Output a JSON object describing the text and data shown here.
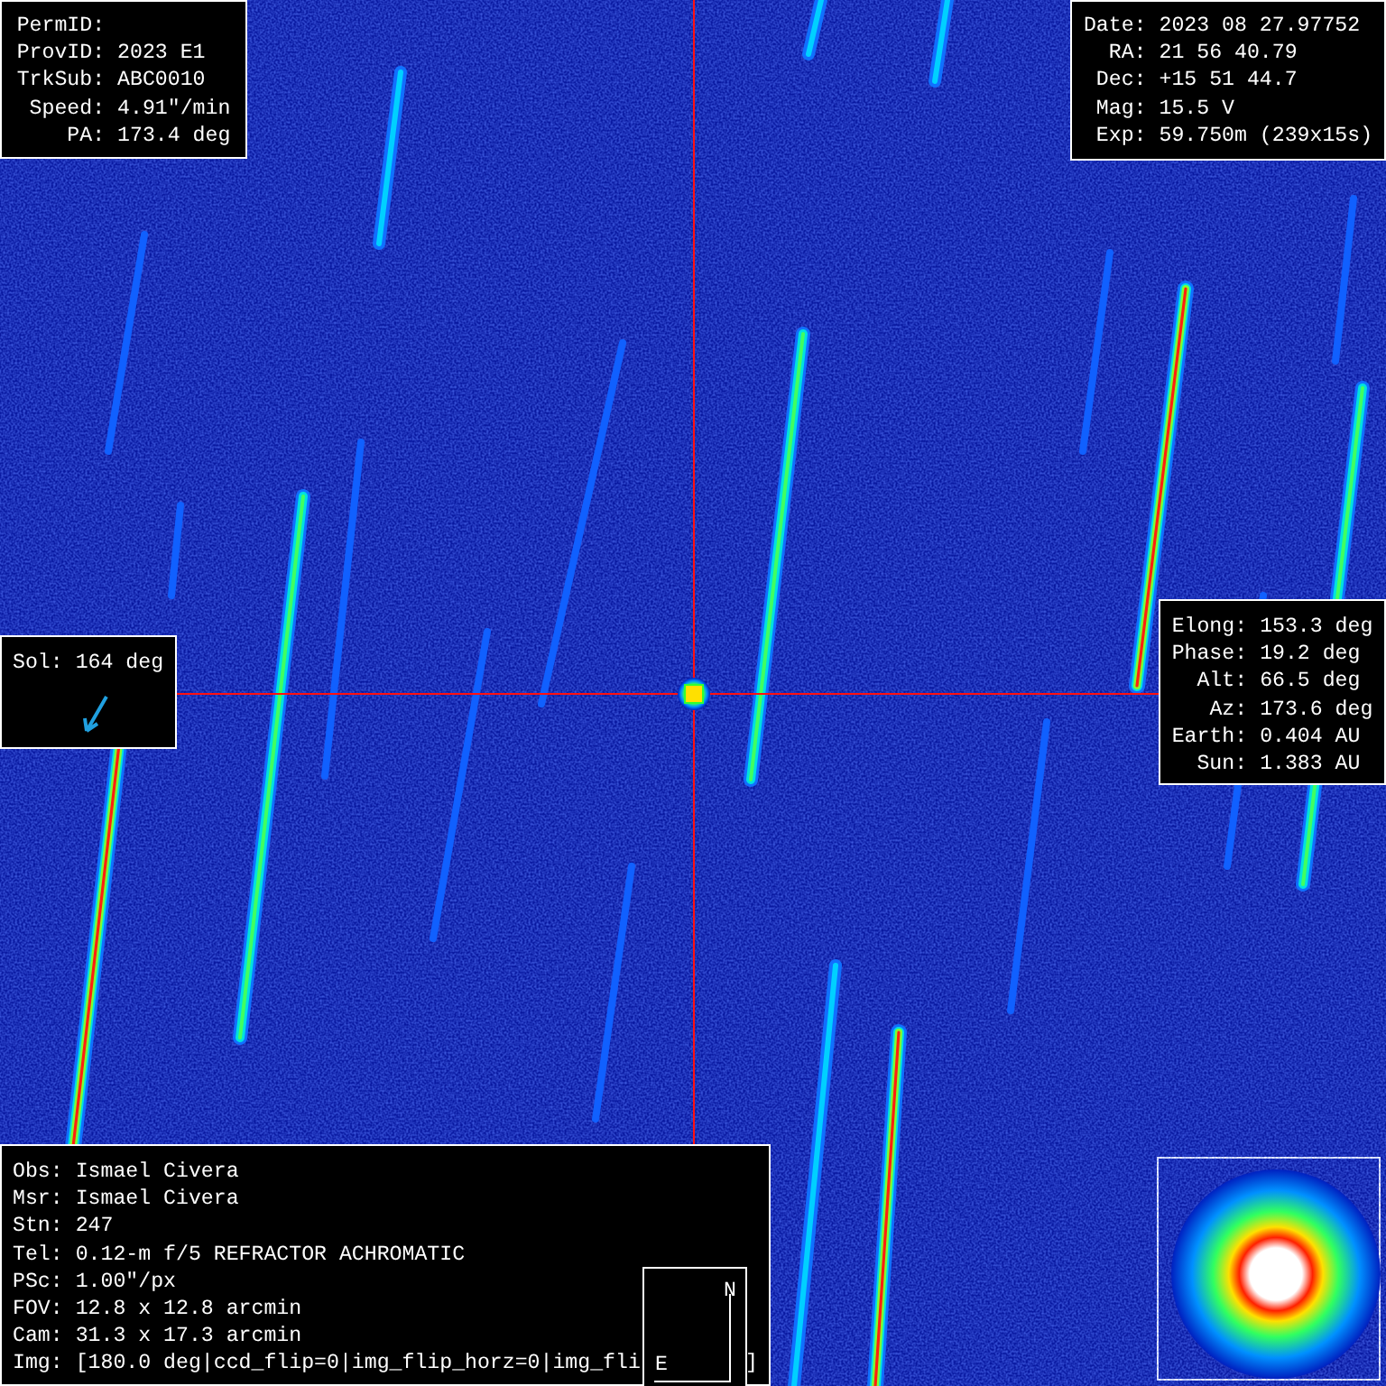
{
  "object_panel": {
    "lines": [
      {
        "label": "PermID:"
      },
      {
        "label": "ProvID:",
        "value": "2023 E1"
      },
      {
        "label": "TrkSub:",
        "value": "ABC0010"
      },
      {
        "label": "Speed:",
        "value": "4.91\"/min"
      },
      {
        "label": "PA:",
        "value": "173.4 deg"
      }
    ]
  },
  "observation_panel": {
    "lines": [
      {
        "label": "Date:",
        "value": "2023 08 27.97752"
      },
      {
        "label": "RA:",
        "value": "21 56 40.79"
      },
      {
        "label": "Dec:",
        "value": "+15 51 44.7"
      },
      {
        "label": "Mag:",
        "value": "15.5 V"
      },
      {
        "label": "Exp:",
        "value": "59.750m (239x15s)"
      }
    ]
  },
  "sun_panel": {
    "label": "Sol:",
    "value": "164 deg"
  },
  "geometry_panel": {
    "lines": [
      {
        "label": "Elong:",
        "value": "153.3 deg"
      },
      {
        "label": "Phase:",
        "value": "19.2 deg"
      },
      {
        "label": "Alt:",
        "value": "66.5 deg"
      },
      {
        "label": "Az:",
        "value": "173.6 deg"
      },
      {
        "label": "Earth:",
        "value": "0.404 AU"
      },
      {
        "label": "Sun:",
        "value": "1.383 AU"
      }
    ]
  },
  "info_panel": {
    "lines": [
      {
        "label": "Obs:",
        "value": "Ismael Civera"
      },
      {
        "label": "Msr:",
        "value": "Ismael Civera"
      },
      {
        "label": "Stn:",
        "value": "247"
      },
      {
        "label": "Tel:",
        "value": "0.12-m f/5 REFRACTOR ACHROMATIC"
      },
      {
        "label": "PSc:",
        "value": "1.00\"/px"
      },
      {
        "label": "FOV:",
        "value": "12.8 x 12.8 arcmin"
      },
      {
        "label": "Cam:",
        "value": "31.3 x 17.3 arcmin"
      },
      {
        "label": "Img:",
        "value": "[180.0 deg|ccd_flip=0|img_flip_horz=0|img_fli",
        "tail": "]"
      }
    ]
  },
  "compass": {
    "north": "N",
    "east": "E"
  }
}
